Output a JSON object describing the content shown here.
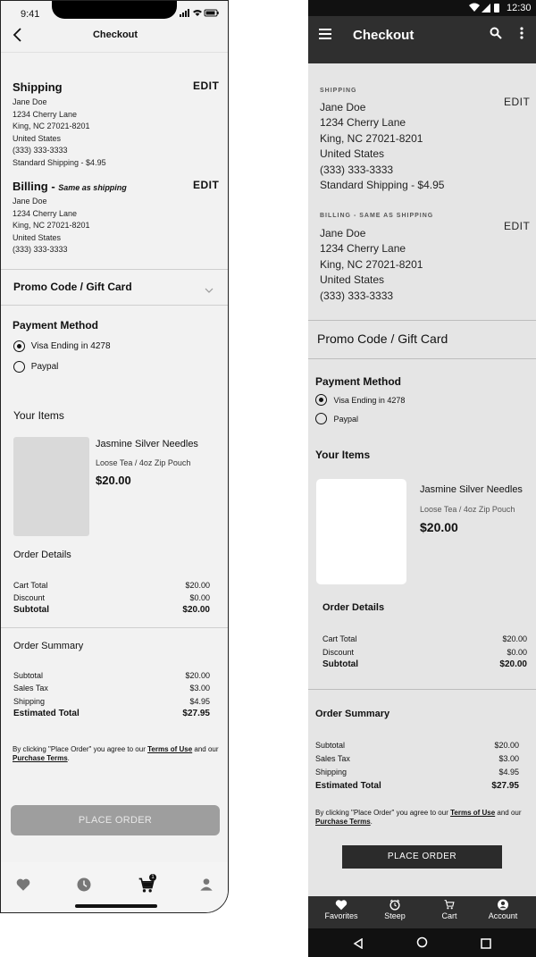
{
  "ios": {
    "status_time": "9:41",
    "nav_title": "Checkout",
    "shipping": {
      "title": "Shipping",
      "edit": "EDIT",
      "lines": [
        "Jane Doe",
        "1234 Cherry Lane",
        "King, NC 27021-8201",
        "United States",
        "(333) 333-3333",
        "Standard Shipping - $4.95"
      ]
    },
    "billing": {
      "title": "Billing - ",
      "subtitle": "Same as shipping",
      "edit": "EDIT",
      "lines": [
        "Jane Doe",
        "1234 Cherry Lane",
        "King, NC 27021-8201",
        "United States",
        "(333) 333-3333"
      ]
    },
    "promo": "Promo Code / Gift Card",
    "payment": {
      "title": "Payment Method",
      "options": [
        "Visa Ending in 4278",
        "Paypal"
      ]
    },
    "items_title": "Your Items",
    "item": {
      "name": "Jasmine Silver Needles",
      "desc": "Loose Tea / 4oz Zip Pouch",
      "price": "$20.00"
    },
    "order_details": {
      "title": "Order Details",
      "rows": [
        {
          "label": "Cart Total",
          "value": "$20.00"
        },
        {
          "label": "Discount",
          "value": "$0.00"
        },
        {
          "label": "Subtotal",
          "value": "$20.00"
        }
      ]
    },
    "order_summary": {
      "title": "Order Summary",
      "rows": [
        {
          "label": "Subtotal",
          "value": "$20.00"
        },
        {
          "label": "Sales Tax",
          "value": "$3.00"
        },
        {
          "label": "Shipping",
          "value": "$4.95"
        },
        {
          "label": "Estimated Total",
          "value": "$27.95"
        }
      ]
    },
    "terms": {
      "pre": "By clicking \"Place Order\" you agree to our ",
      "link1": "Terms of Use",
      "mid": " and our ",
      "link2": "Purchase Terms",
      "post": "."
    },
    "place_order": "PLACE ORDER",
    "tabs": [
      "heart-icon",
      "clock-icon",
      "cart-icon",
      "user-icon"
    ],
    "cart_badge": "1"
  },
  "android": {
    "status_time": "12:30",
    "toolbar_title": "Checkout",
    "shipping": {
      "label": "SHIPPING",
      "edit": "EDIT",
      "lines": [
        "Jane Doe",
        "1234 Cherry Lane",
        "King, NC 27021-8201",
        "United States",
        "(333) 333-3333",
        "Standard Shipping - $4.95"
      ]
    },
    "billing": {
      "label": "BILLING - SAME AS SHIPPING",
      "edit": "EDIT",
      "lines": [
        "Jane Doe",
        "1234 Cherry Lane",
        "King, NC 27021-8201",
        "United States",
        "(333) 333-3333"
      ]
    },
    "promo": "Promo Code / Gift Card",
    "payment": {
      "title": "Payment Method",
      "options": [
        "Visa Ending in 4278",
        "Paypal"
      ]
    },
    "items_title": "Your Items",
    "item": {
      "name": "Jasmine Silver Needles",
      "desc": "Loose Tea / 4oz Zip Pouch",
      "price": "$20.00"
    },
    "order_details": {
      "title": "Order Details",
      "rows": [
        {
          "label": "Cart Total",
          "value": "$20.00"
        },
        {
          "label": "Discount",
          "value": "$0.00"
        },
        {
          "label": "Subtotal",
          "value": "$20.00"
        }
      ]
    },
    "order_summary": {
      "title": "Order Summary",
      "rows": [
        {
          "label": "Subtotal",
          "value": "$20.00"
        },
        {
          "label": "Sales Tax",
          "value": "$3.00"
        },
        {
          "label": "Shipping",
          "value": "$4.95"
        },
        {
          "label": "Estimated Total",
          "value": "$27.95"
        }
      ]
    },
    "terms": {
      "pre": "By clicking \"Place Order\" you agree to our ",
      "link1": "Terms of Use",
      "mid": " and our ",
      "link2": "Purchase Terms",
      "post": "."
    },
    "place_order": "PLACE ORDER",
    "bottom_nav": [
      "Favorites",
      "Steep",
      "Cart",
      "Account"
    ]
  }
}
